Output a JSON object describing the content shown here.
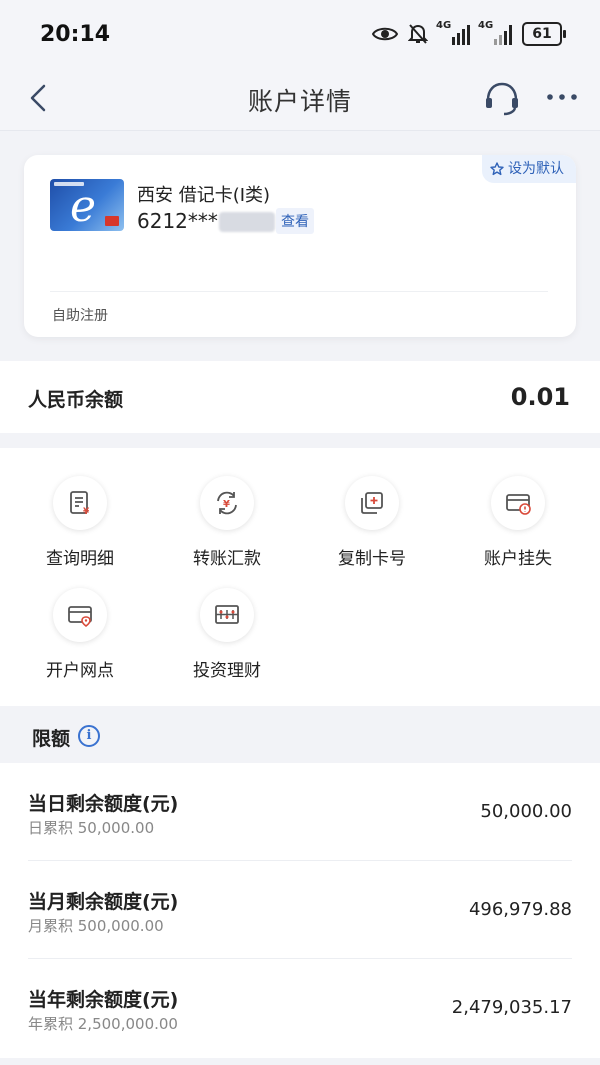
{
  "status_bar": {
    "time": "20:14",
    "net1": "4G",
    "net2": "4G",
    "battery": "61"
  },
  "nav": {
    "title": "账户详情"
  },
  "card": {
    "default_label": "设为默认",
    "name": "西安 借记卡(I类)",
    "number_masked": "6212***",
    "view_label": "查看",
    "registration": "自助注册"
  },
  "balance": {
    "label": "人民币余额",
    "value": "0.01"
  },
  "actions": [
    {
      "label": "查询明细",
      "icon": "statement-icon"
    },
    {
      "label": "转账汇款",
      "icon": "transfer-icon"
    },
    {
      "label": "复制卡号",
      "icon": "copy-card-icon"
    },
    {
      "label": "账户挂失",
      "icon": "report-loss-icon"
    },
    {
      "label": "开户网点",
      "icon": "branch-location-icon"
    },
    {
      "label": "投资理财",
      "icon": "investment-icon"
    }
  ],
  "limits": {
    "title": "限额",
    "rows": [
      {
        "title": "当日剩余额度(元)",
        "sub": "日累积 50,000.00",
        "value": "50,000.00"
      },
      {
        "title": "当月剩余额度(元)",
        "sub": "月累积 500,000.00",
        "value": "496,979.88"
      },
      {
        "title": "当年剩余额度(元)",
        "sub": "年累积 2,500,000.00",
        "value": "2,479,035.17"
      }
    ]
  },
  "colors": {
    "accent": "#2f62b8",
    "icon_red": "#d94a3a",
    "background": "#f2f3f7"
  }
}
